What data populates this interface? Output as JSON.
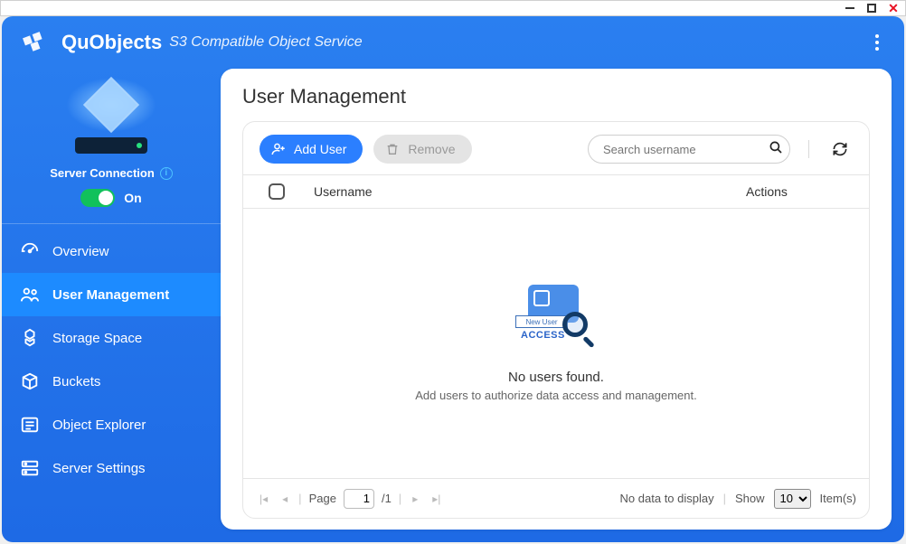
{
  "app": {
    "name": "QuObjects",
    "subtitle": "S3 Compatible Object Service"
  },
  "server": {
    "connection_label": "Server Connection",
    "state_label": "On"
  },
  "nav": {
    "overview": "Overview",
    "user_mgmt": "User Management",
    "storage": "Storage Space",
    "buckets": "Buckets",
    "explorer": "Object Explorer",
    "settings": "Server Settings"
  },
  "page": {
    "title": "User Management"
  },
  "toolbar": {
    "add_user": "Add User",
    "remove": "Remove",
    "search_placeholder": "Search username"
  },
  "table": {
    "col_username": "Username",
    "col_actions": "Actions"
  },
  "empty": {
    "tag": "New User",
    "access": "ACCESS",
    "line1": "No users found.",
    "line2": "Add users to authorize data access and management."
  },
  "pager": {
    "page_label": "Page",
    "current": "1",
    "total": "1",
    "no_data": "No data to display",
    "show_label": "Show",
    "page_size": "10",
    "items_label": "Item(s)"
  }
}
